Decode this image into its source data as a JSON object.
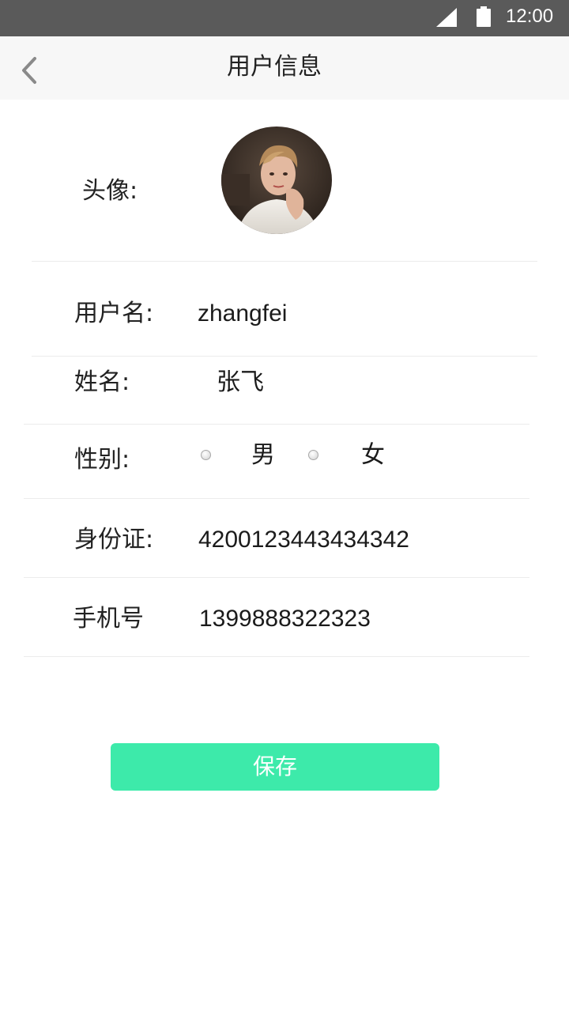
{
  "status_bar": {
    "time": "12:00",
    "icons": [
      "signal-icon",
      "battery-icon"
    ]
  },
  "nav": {
    "title": "用户信息",
    "back_icon": "chevron-left-icon"
  },
  "profile": {
    "avatar_label": "头像:",
    "username_label": "用户名:",
    "username_value": "zhangfei",
    "name_label": "姓名:",
    "name_value": "张飞",
    "gender_label": "性别:",
    "gender_options": [
      "男",
      "女"
    ],
    "id_label": "身份证:",
    "id_value": "4200123443434342",
    "phone_label": "手机号",
    "phone_value": "1399888322323"
  },
  "actions": {
    "save_label": "保存"
  },
  "colors": {
    "status_bar": "#5a5a5a",
    "nav_bar": "#f7f7f7",
    "accent": "#3deaaa",
    "divider": "#ececec"
  }
}
